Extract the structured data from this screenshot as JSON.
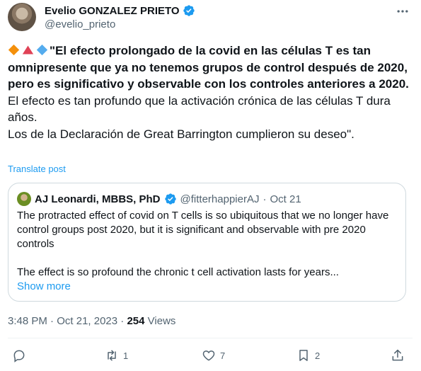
{
  "author": {
    "name": "Evelio GONZALEZ PRIETO",
    "handle": "@evelio_prieto",
    "verified_color": "#1d9bf0"
  },
  "tweet": {
    "emojis": [
      "orange-diamond",
      "red-triangle",
      "blue-diamond"
    ],
    "bold_text": "\"El efecto prolongado de la covid en las células T es tan omnipresente que ya no tenemos grupos de control después de 2020, pero es significativo y observable con los controles anteriores a 2020.",
    "line2": "El efecto es tan profundo que la activación crónica de las células T dura años.",
    "line3": "Los de la Declaración de Great Barrington cumplieron su deseo\".",
    "translate_label": "Translate post"
  },
  "quote": {
    "author_name": "AJ Leonardi, MBBS, PhD",
    "handle": "@fitterhappierAJ",
    "separator": "·",
    "date": "Oct 21",
    "text_line1": "The protracted effect of covid on T cells is so ubiquitous that we no longer have control groups post 2020, but it is significant and observable with pre 2020 controls",
    "text_line2": "The effect is so profound the chronic t cell activation lasts for years...",
    "show_more": "Show more"
  },
  "meta": {
    "time": "3:48 PM",
    "separator": "·",
    "date": "Oct 21, 2023",
    "separator2": "·",
    "views_count": "254",
    "views_label": "Views"
  },
  "actions": {
    "reply_icon": "reply-icon",
    "retweet_count": "1",
    "like_count": "7",
    "bookmark_count": "2",
    "share_icon": "share-icon"
  },
  "colors": {
    "accent": "#1d9bf0",
    "muted": "#536471",
    "text": "#0f1419",
    "border": "#cfd9de"
  }
}
